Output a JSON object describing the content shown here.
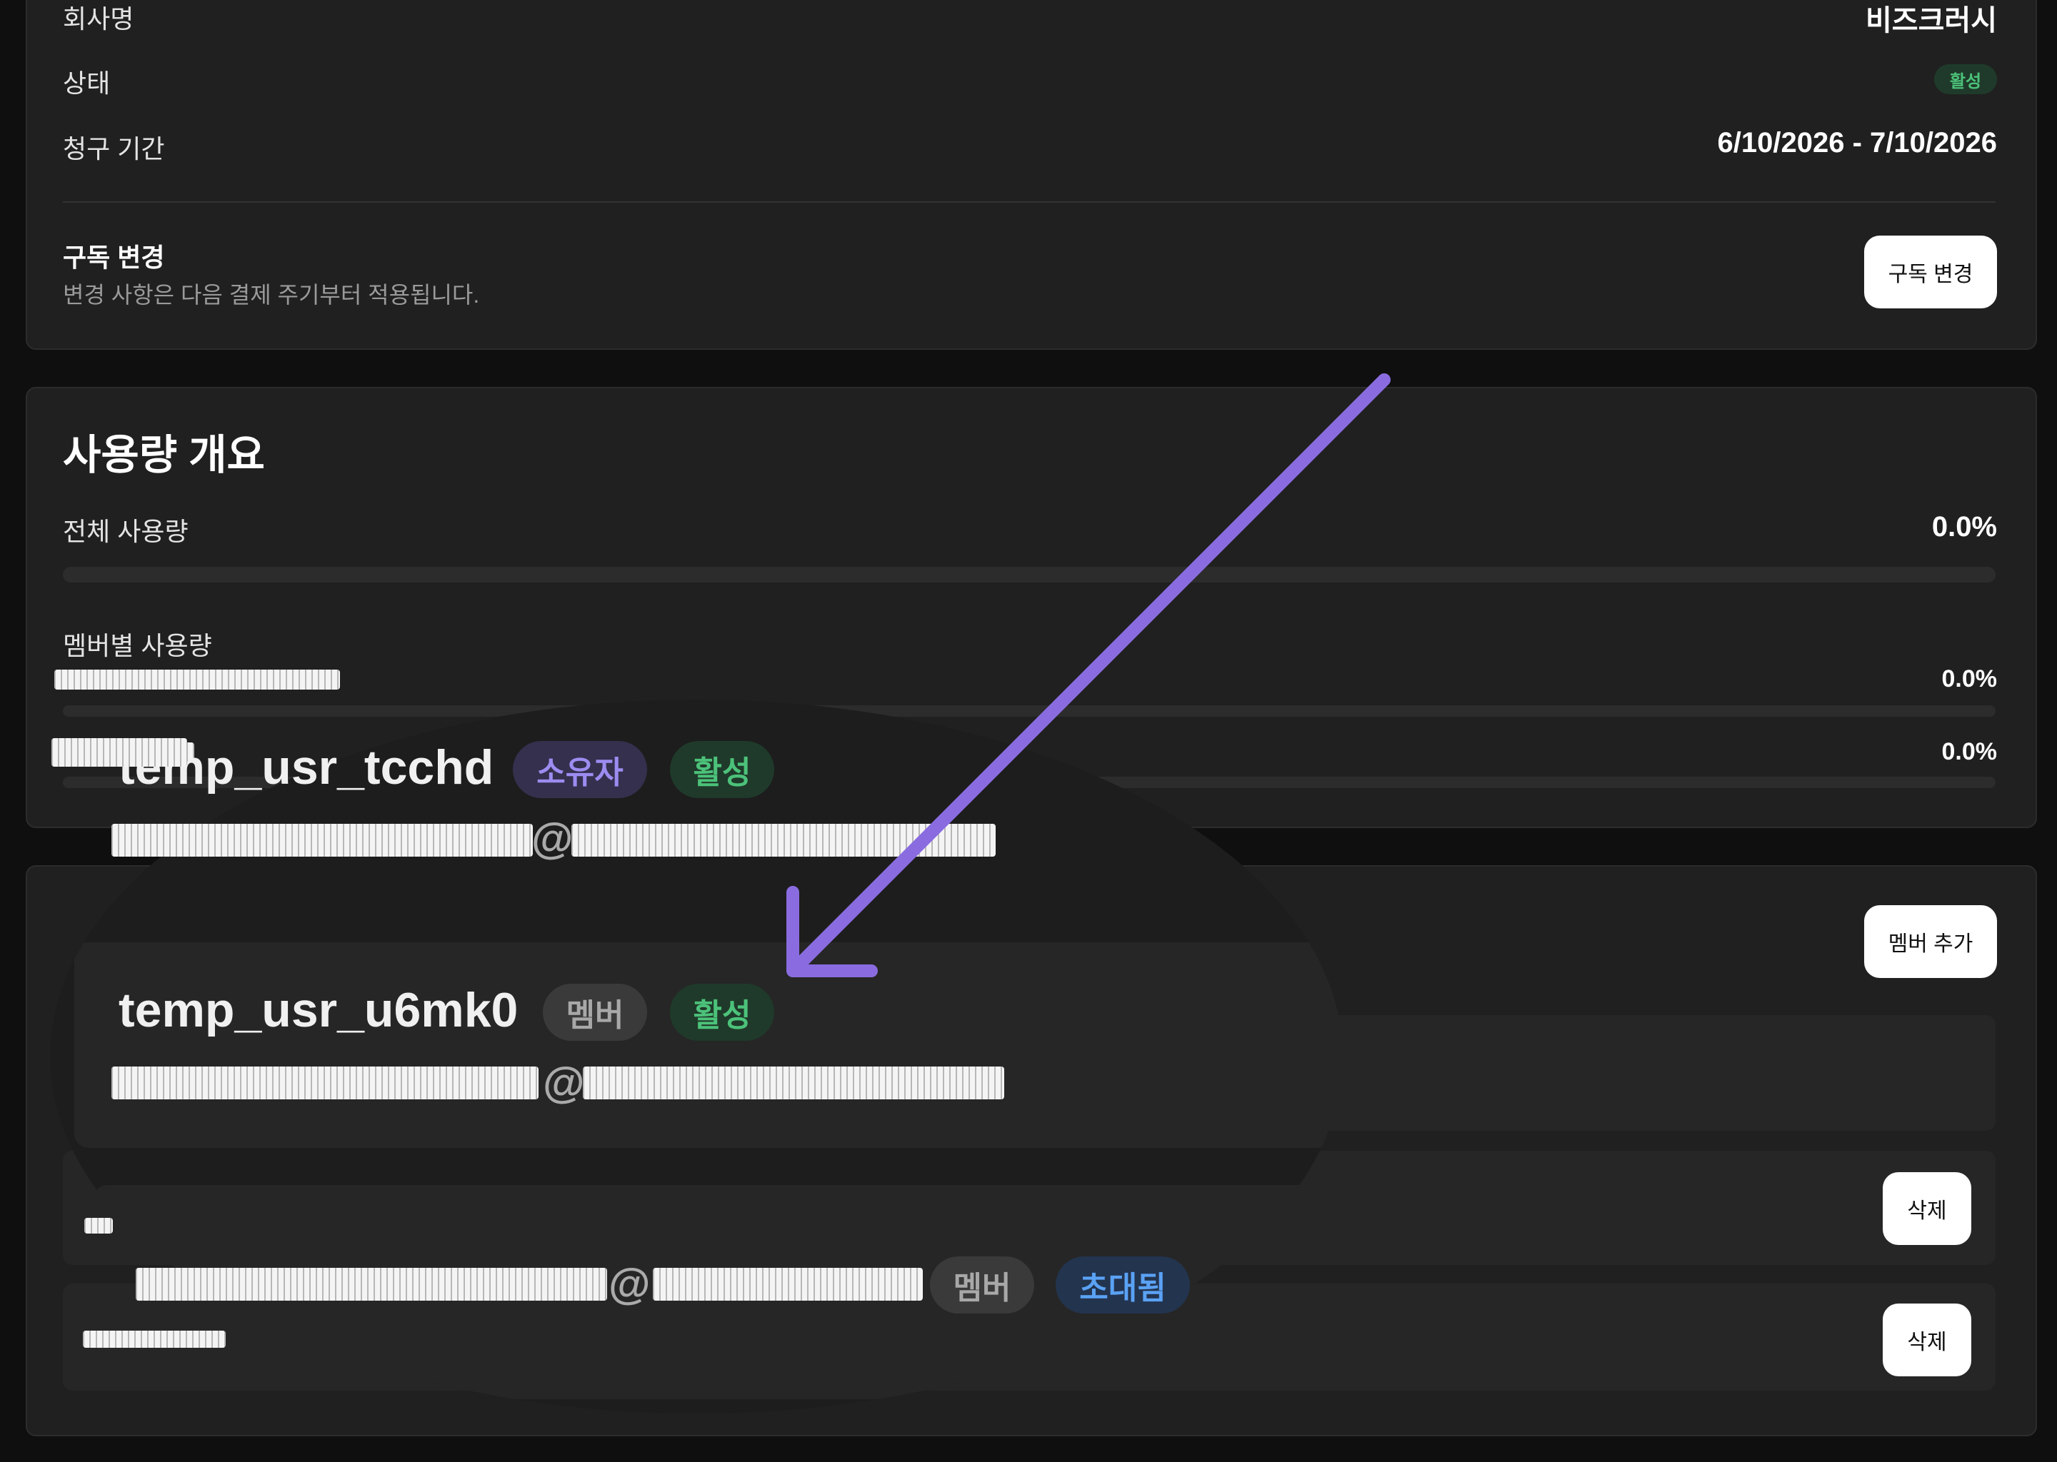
{
  "subscription": {
    "company_label": "회사명",
    "company_value": "비즈크러시",
    "status_label": "상태",
    "status_value": "활성",
    "billing_label": "청구 기간",
    "billing_value": "6/10/2026 - 7/10/2026",
    "change_title": "구독 변경",
    "change_desc": "변경 사항은 다음 결제 주기부터 적용됩니다.",
    "change_button": "구독 변경"
  },
  "usage": {
    "title": "사용량 개요",
    "total_label": "전체 사용량",
    "total_value": "0.0%",
    "total_fraction": 0.0,
    "member_label": "멤버별 사용량",
    "members": [
      {
        "value": "0.0%",
        "fraction": 0.0
      },
      {
        "value": "0.0%",
        "fraction": 0.0
      }
    ]
  },
  "members_section": {
    "add_button": "멤버 추가",
    "delete_button": "삭제",
    "delete_button_2": "삭제"
  },
  "zoom": {
    "user1_name": "temp_usr_tcchd",
    "user1_role": "소유자",
    "user1_status": "활성",
    "user2_name": "temp_usr_u6mk0",
    "user2_role": "멤버",
    "user2_status": "활성",
    "user3_role": "멤버",
    "user3_status": "초대됨",
    "at": "@"
  },
  "colors": {
    "arrow": "#8a6ce0",
    "badge_active_bg": "#1f3a2a",
    "badge_active_fg": "#4cc27a",
    "badge_owner_bg": "#34304e",
    "badge_owner_fg": "#9d8cf0",
    "badge_member_bg": "#3a3a3a",
    "badge_member_fg": "#a8a8a8",
    "badge_invited_bg": "#23344f",
    "badge_invited_fg": "#5aa2f5"
  }
}
